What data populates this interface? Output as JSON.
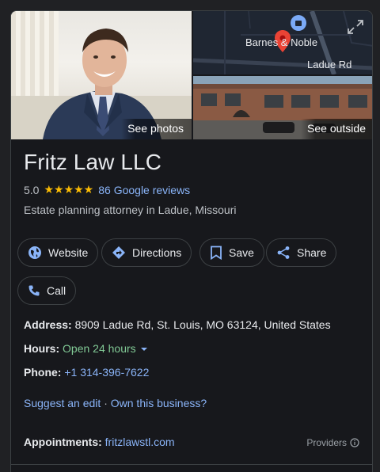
{
  "media": {
    "see_photos": "See photos",
    "see_outside": "See outside",
    "map_place": "Barnes & Noble",
    "map_road": "Ladue Rd"
  },
  "business": {
    "name": "Fritz Law LLC",
    "rating": "5.0",
    "stars": "★★★★★",
    "reviews": "86 Google reviews",
    "category": "Estate planning attorney in Ladue, Missouri"
  },
  "actions": {
    "website": "Website",
    "directions": "Directions",
    "save": "Save",
    "share": "Share",
    "call": "Call"
  },
  "details": {
    "address_label": "Address:",
    "address": "8909 Ladue Rd, St. Louis, MO 63124, United States",
    "hours_label": "Hours:",
    "hours": "Open 24 hours",
    "phone_label": "Phone:",
    "phone": "+1 314-396-7622",
    "suggest_edit": "Suggest an edit",
    "separator": "·",
    "own_business": "Own this business?",
    "appointments_label": "Appointments:",
    "appointments": "fritzlawstl.com",
    "providers": "Providers"
  },
  "colors": {
    "accent_link": "#8ab4f8",
    "open_green": "#81c995",
    "star": "#fbbc04",
    "pin": "#ea4335"
  }
}
